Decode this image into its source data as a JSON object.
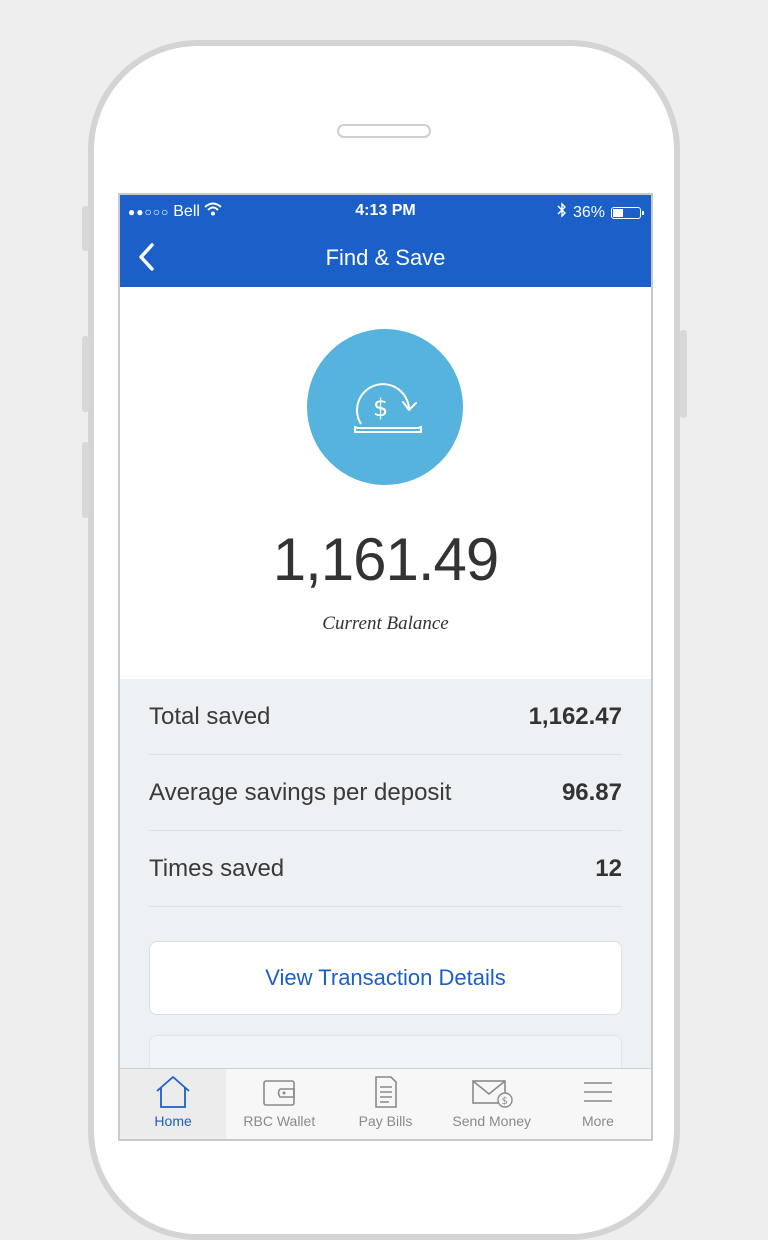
{
  "status_bar": {
    "signal": "●●○○○",
    "carrier": "Bell",
    "time": "4:13 PM",
    "battery_text": "36%",
    "battery_level": 0.36
  },
  "nav": {
    "title": "Find & Save"
  },
  "hero": {
    "icon": "savings-dollar-icon",
    "balance": "1,161.49",
    "balance_label": "Current Balance"
  },
  "stats": [
    {
      "label": "Total saved",
      "value": "1,162.47"
    },
    {
      "label": "Average savings per deposit",
      "value": "96.87"
    },
    {
      "label": "Times saved",
      "value": "12"
    }
  ],
  "view_button": {
    "label": "View Transaction Details"
  },
  "tabs": [
    {
      "label": "Home",
      "icon": "home-icon",
      "active": true
    },
    {
      "label": "RBC Wallet",
      "icon": "wallet-icon",
      "active": false
    },
    {
      "label": "Pay Bills",
      "icon": "bill-icon",
      "active": false
    },
    {
      "label": "Send Money",
      "icon": "send-money-icon",
      "active": false
    },
    {
      "label": "More",
      "icon": "menu-icon",
      "active": false
    }
  ],
  "colors": {
    "brand_blue": "#1b5fc9",
    "icon_circle": "#55b3dd",
    "stats_bg": "#edf1f4"
  }
}
